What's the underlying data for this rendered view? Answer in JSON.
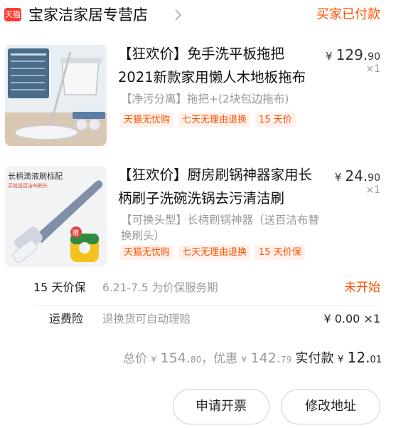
{
  "header": {
    "badge_text": "天猫",
    "shop_name": "宝家洁家居专营店",
    "order_status": "买家已付款",
    "accent_color": "#ff5000"
  },
  "products": [
    {
      "title": "【狂欢价】免手洗平板拖把2021新款家用懒人木地板拖布",
      "price_currency": "¥",
      "price_int": "129.",
      "price_dec": "90",
      "quantity": "×1",
      "sku": "【净污分离】拖把+(2块包边拖布)",
      "tags": [
        "天猫无忧购",
        "七天无理由退换",
        "15 天价"
      ],
      "image_icon": "spin-mop-bucket-image"
    },
    {
      "title": "【狂欢价】厨房刷锅神器家用长柄刷子洗碗洗锅去污清洁刷",
      "price_currency": "¥",
      "price_int": "24.",
      "price_dec": "90",
      "quantity": "×1",
      "sku": "【可换头型】长柄刷锅神器（送百洁布替换刷头）",
      "tags": [
        "天猫无忧购",
        "七天无理由退换",
        "15 天价保"
      ],
      "image_icon": "dish-brush-image",
      "image_caption": "长柄滴液刷标配",
      "image_subcaption": "买就送百洁布刷头",
      "gift_badge": "赠"
    }
  ],
  "price_protection": {
    "label": "15 天价保",
    "desc": "6.21-7.5 为价保服务期",
    "status": "未开始"
  },
  "shipping_insurance": {
    "label": "运费险",
    "desc": "退换货可自动理赔",
    "value": "¥ 0.00 ×1"
  },
  "totals": {
    "total_label": "总价",
    "total_currency": "¥",
    "total_int": "154.",
    "total_dec": "80",
    "discount_label": "，优惠",
    "discount_currency": "¥",
    "discount_int": "142.",
    "discount_dec": "79",
    "paid_label": "实付款",
    "paid_currency": "¥",
    "paid_int": "12.",
    "paid_dec": "01"
  },
  "actions": {
    "invoice_label": "申请开票",
    "address_label": "修改地址"
  }
}
